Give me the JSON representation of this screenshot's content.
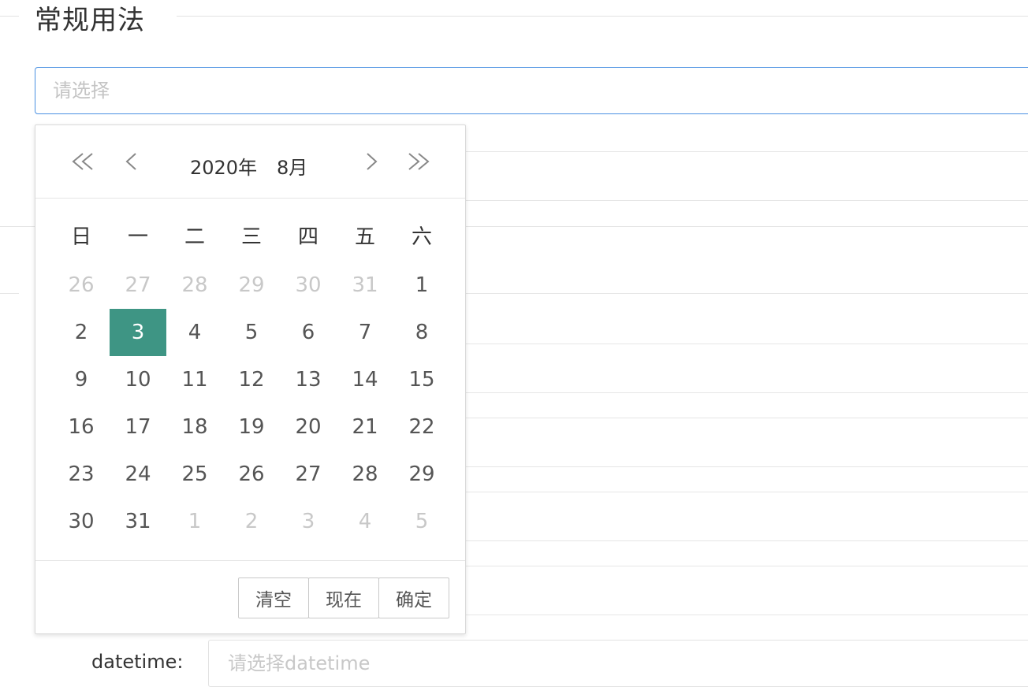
{
  "section": {
    "title": "常规用法"
  },
  "main_input": {
    "placeholder": "请选择"
  },
  "calendar": {
    "header": {
      "year": "2020年",
      "month": "8月"
    },
    "weekdays": [
      "日",
      "一",
      "二",
      "三",
      "四",
      "五",
      "六"
    ],
    "weeks": [
      [
        {
          "d": "26",
          "o": true
        },
        {
          "d": "27",
          "o": true
        },
        {
          "d": "28",
          "o": true
        },
        {
          "d": "29",
          "o": true
        },
        {
          "d": "30",
          "o": true
        },
        {
          "d": "31",
          "o": true
        },
        {
          "d": "1",
          "o": false
        }
      ],
      [
        {
          "d": "2",
          "o": false
        },
        {
          "d": "3",
          "o": false,
          "sel": true
        },
        {
          "d": "4",
          "o": false
        },
        {
          "d": "5",
          "o": false
        },
        {
          "d": "6",
          "o": false
        },
        {
          "d": "7",
          "o": false
        },
        {
          "d": "8",
          "o": false
        }
      ],
      [
        {
          "d": "9",
          "o": false
        },
        {
          "d": "10",
          "o": false
        },
        {
          "d": "11",
          "o": false
        },
        {
          "d": "12",
          "o": false
        },
        {
          "d": "13",
          "o": false
        },
        {
          "d": "14",
          "o": false
        },
        {
          "d": "15",
          "o": false
        }
      ],
      [
        {
          "d": "16",
          "o": false
        },
        {
          "d": "17",
          "o": false
        },
        {
          "d": "18",
          "o": false
        },
        {
          "d": "19",
          "o": false
        },
        {
          "d": "20",
          "o": false
        },
        {
          "d": "21",
          "o": false
        },
        {
          "d": "22",
          "o": false
        }
      ],
      [
        {
          "d": "23",
          "o": false
        },
        {
          "d": "24",
          "o": false
        },
        {
          "d": "25",
          "o": false
        },
        {
          "d": "26",
          "o": false
        },
        {
          "d": "27",
          "o": false
        },
        {
          "d": "28",
          "o": false
        },
        {
          "d": "29",
          "o": false
        }
      ],
      [
        {
          "d": "30",
          "o": false
        },
        {
          "d": "31",
          "o": false
        },
        {
          "d": "1",
          "o": true
        },
        {
          "d": "2",
          "o": true
        },
        {
          "d": "3",
          "o": true
        },
        {
          "d": "4",
          "o": true
        },
        {
          "d": "5",
          "o": true
        }
      ]
    ],
    "footer": {
      "clear": "清空",
      "now": "现在",
      "confirm": "确定"
    },
    "selected_color": "#3e9584"
  },
  "bottom_row": {
    "label": "datetime:",
    "placeholder": "请选择datetime"
  },
  "colors": {
    "focus_border": "#4a90e2",
    "other_month": "#c8c8c8"
  }
}
